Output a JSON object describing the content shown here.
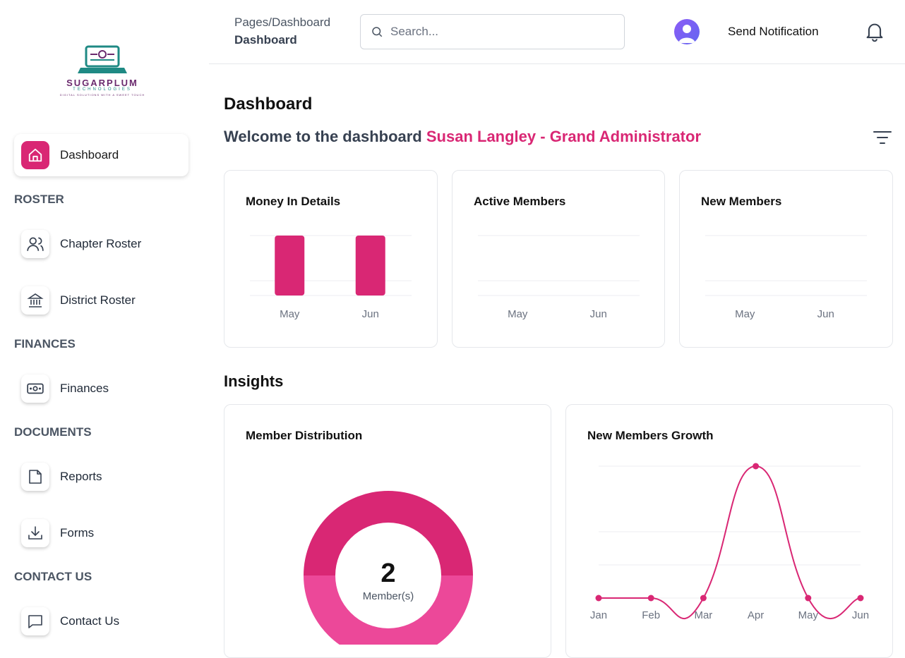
{
  "logo": {
    "name": "SUGARPLUM",
    "sub": "TECHNOLOGIES",
    "tagline": "DIGITAL SOLUTIONS WITH A SWEET TOUCH"
  },
  "sidebar": {
    "active": {
      "label": "Dashboard",
      "icon": "home-icon"
    },
    "sections": [
      {
        "title": "ROSTER",
        "items": [
          {
            "label": "Chapter Roster",
            "icon": "users-icon"
          },
          {
            "label": "District Roster",
            "icon": "bank-icon"
          }
        ]
      },
      {
        "title": "FINANCES",
        "items": [
          {
            "label": "Finances",
            "icon": "money-icon"
          }
        ]
      },
      {
        "title": "DOCUMENTS",
        "items": [
          {
            "label": "Reports",
            "icon": "file-icon"
          },
          {
            "label": "Forms",
            "icon": "download-icon"
          }
        ]
      },
      {
        "title": "CONTACT US",
        "items": [
          {
            "label": "Contact Us",
            "icon": "message-icon"
          }
        ]
      }
    ]
  },
  "header": {
    "breadcrumb_root": "Pages",
    "breadcrumb_sep": "/",
    "breadcrumb_current": "Dashboard",
    "title": "Dashboard",
    "search_placeholder": "Search...",
    "send_notification": "Send Notification"
  },
  "page": {
    "title": "Dashboard",
    "welcome_prefix": "Welcome to the dashboard",
    "welcome_name": "Susan Langley - Grand Administrator",
    "insights_title": "Insights"
  },
  "colors": {
    "accent": "#d92774",
    "accent_light": "#ec4899"
  },
  "chart_data": [
    {
      "type": "bar",
      "title": "Money In Details",
      "categories": [
        "May",
        "Jun"
      ],
      "values": [
        2,
        2
      ],
      "ylim": [
        0,
        2
      ]
    },
    {
      "type": "bar",
      "title": "Active Members",
      "categories": [
        "May",
        "Jun"
      ],
      "values": [
        0,
        0
      ]
    },
    {
      "type": "bar",
      "title": "New Members",
      "categories": [
        "May",
        "Jun"
      ],
      "values": [
        0,
        0
      ]
    },
    {
      "type": "pie",
      "title": "Member Distribution",
      "center_value": "2",
      "center_label": "Member(s)",
      "values": [
        1,
        1
      ]
    },
    {
      "type": "line",
      "title": "New Members Growth",
      "categories": [
        "Jan",
        "Feb",
        "Mar",
        "Apr",
        "May",
        "Jun"
      ],
      "values": [
        0,
        0,
        0,
        2,
        0,
        0
      ],
      "ylim": [
        0,
        2
      ]
    }
  ]
}
